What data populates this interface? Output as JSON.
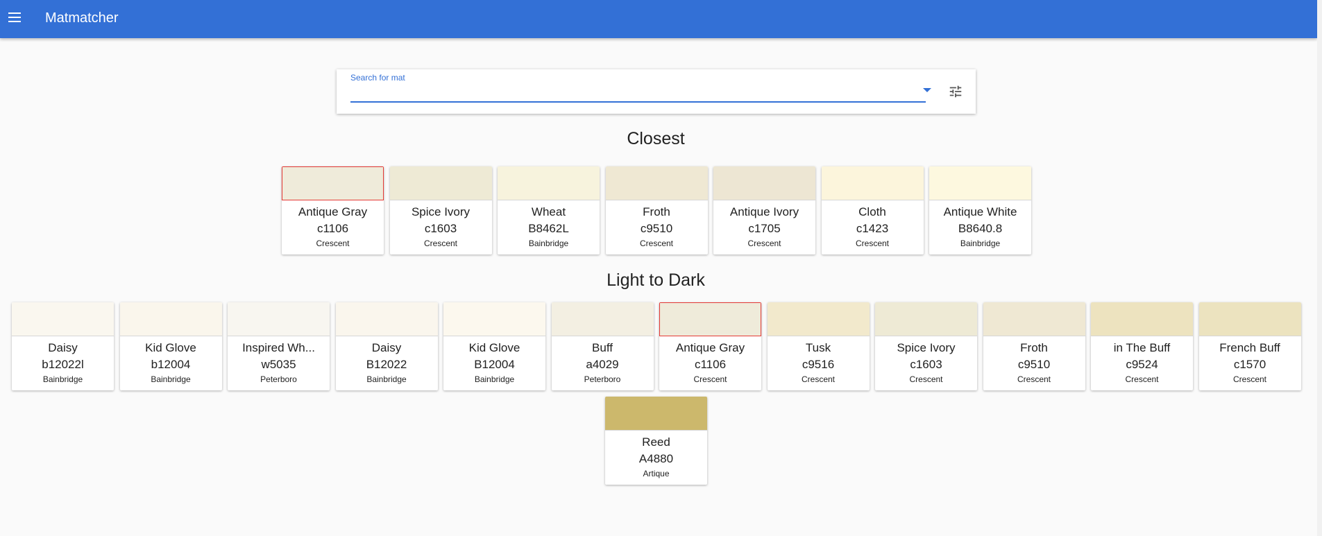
{
  "app": {
    "title": "Matmatcher"
  },
  "search": {
    "label": "Search for mat",
    "value": "",
    "placeholder": ""
  },
  "sections": {
    "closest": "Closest",
    "light_to_dark": "Light to Dark"
  },
  "closest": [
    {
      "name": "Antique Gray",
      "code": "c1106",
      "maker": "Crescent",
      "color": "#efebda",
      "selected": true
    },
    {
      "name": "Spice Ivory",
      "code": "c1603",
      "maker": "Crescent",
      "color": "#eeead5",
      "selected": false
    },
    {
      "name": "Wheat",
      "code": "B8462L",
      "maker": "Bainbridge",
      "color": "#f7f3dd",
      "selected": false
    },
    {
      "name": "Froth",
      "code": "c9510",
      "maker": "Crescent",
      "color": "#efe8d3",
      "selected": false
    },
    {
      "name": "Antique Ivory",
      "code": "c1705",
      "maker": "Crescent",
      "color": "#ede6d3",
      "selected": false
    },
    {
      "name": "Cloth",
      "code": "c1423",
      "maker": "Crescent",
      "color": "#fcf5dc",
      "selected": false
    },
    {
      "name": "Antique White",
      "code": "B8640.8",
      "maker": "Bainbridge",
      "color": "#fdf8df",
      "selected": false
    }
  ],
  "light_to_dark": [
    {
      "name": "Daisy",
      "code": "b12022l",
      "maker": "Bainbridge",
      "color": "#faf7ef",
      "selected": false
    },
    {
      "name": "Kid Glove",
      "code": "b12004",
      "maker": "Bainbridge",
      "color": "#faf6ec",
      "selected": false
    },
    {
      "name": "Inspired Wh...",
      "code": "w5035",
      "maker": "Peterboro",
      "color": "#f8f6f0",
      "selected": false
    },
    {
      "name": "Daisy",
      "code": "B12022",
      "maker": "Bainbridge",
      "color": "#faf6ed",
      "selected": false
    },
    {
      "name": "Kid Glove",
      "code": "B12004",
      "maker": "Bainbridge",
      "color": "#fcf8ee",
      "selected": false
    },
    {
      "name": "Buff",
      "code": "a4029",
      "maker": "Peterboro",
      "color": "#f3efe2",
      "selected": false
    },
    {
      "name": "Antique Gray",
      "code": "c1106",
      "maker": "Crescent",
      "color": "#efebda",
      "selected": true
    },
    {
      "name": "Tusk",
      "code": "c9516",
      "maker": "Crescent",
      "color": "#f2e9cc",
      "selected": false
    },
    {
      "name": "Spice Ivory",
      "code": "c1603",
      "maker": "Crescent",
      "color": "#eeead5",
      "selected": false
    },
    {
      "name": "Froth",
      "code": "c9510",
      "maker": "Crescent",
      "color": "#efe8d3",
      "selected": false
    },
    {
      "name": "in The Buff",
      "code": "c9524",
      "maker": "Crescent",
      "color": "#ede3bf",
      "selected": false
    },
    {
      "name": "French Buff",
      "code": "c1570",
      "maker": "Crescent",
      "color": "#ece3bf",
      "selected": false
    },
    {
      "name": "Reed",
      "code": "A4880",
      "maker": "Artique",
      "color": "#ccb86c",
      "selected": false
    }
  ]
}
